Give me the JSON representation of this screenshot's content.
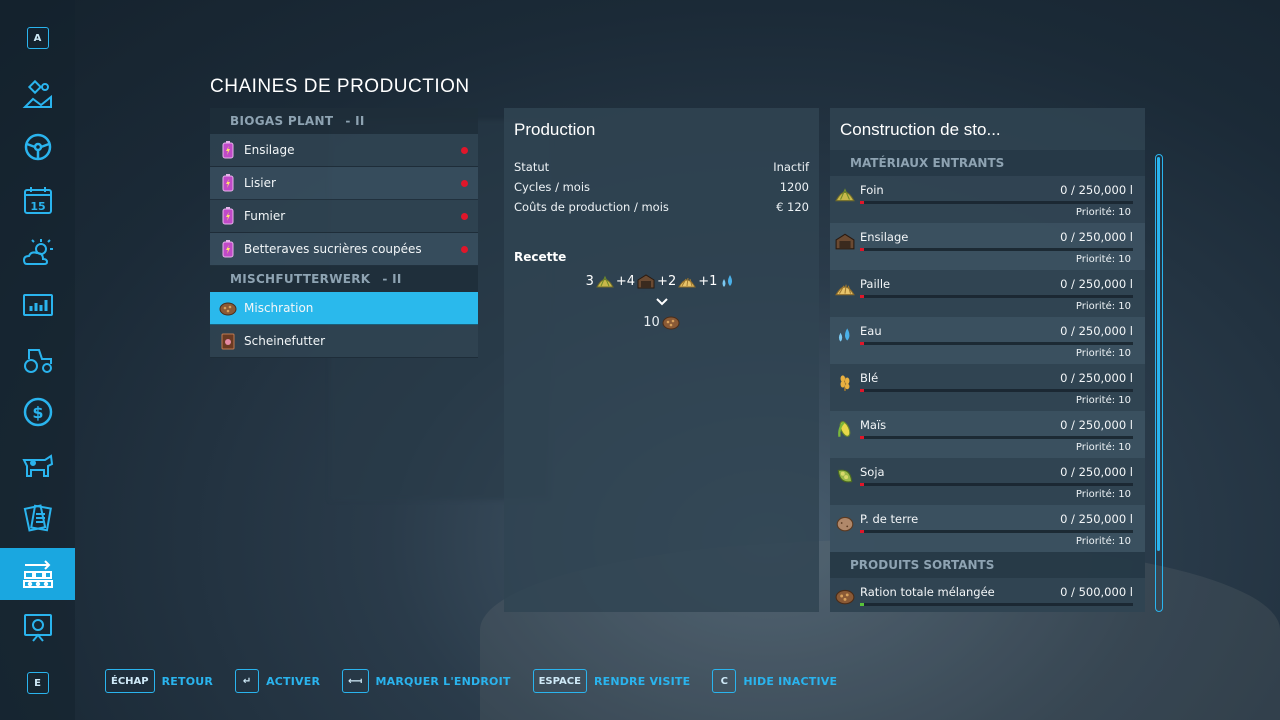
{
  "sidebar": {
    "top_key": "A",
    "bottom_key": "E",
    "items": [
      {
        "icon": "satellite-map-icon"
      },
      {
        "icon": "steering-wheel-icon"
      },
      {
        "icon": "calendar-icon",
        "label": "15"
      },
      {
        "icon": "weather-icon"
      },
      {
        "icon": "statistics-icon"
      },
      {
        "icon": "tractor-icon"
      },
      {
        "icon": "finance-icon",
        "label": "$"
      },
      {
        "icon": "animals-icon"
      },
      {
        "icon": "contracts-icon"
      },
      {
        "icon": "production-icon",
        "active": true
      },
      {
        "icon": "help-board-icon"
      }
    ]
  },
  "page": {
    "title": "CHAINES DE PRODUCTION"
  },
  "chains": [
    {
      "name": "BIOGAS PLANT",
      "suffix": "- II",
      "items": [
        {
          "label": "Ensilage",
          "icon": "battery-icon",
          "inactive": true
        },
        {
          "label": "Lisier",
          "icon": "battery-icon",
          "inactive": true
        },
        {
          "label": "Fumier",
          "icon": "battery-icon",
          "inactive": true
        },
        {
          "label": "Betteraves sucrières coupées",
          "icon": "battery-icon",
          "inactive": true
        }
      ]
    },
    {
      "name": "MISCHFUTTERWERK",
      "suffix": "- II",
      "items": [
        {
          "label": "Mischration",
          "icon": "feed-icon",
          "selected": true
        },
        {
          "label": "Scheinefutter",
          "icon": "pig-food-icon"
        }
      ]
    }
  ],
  "production": {
    "title": "Production",
    "rows": [
      {
        "label": "Statut",
        "value": "Inactif"
      },
      {
        "label": "Cycles / mois",
        "value": "1200"
      },
      {
        "label": "Coûts de production / mois",
        "value": "€ 120"
      }
    ],
    "recipe_label": "Recette",
    "recipe_inputs": [
      {
        "prefix": "3",
        "icon": "hay-icon"
      },
      {
        "prefix": "+4",
        "icon": "silage-icon"
      },
      {
        "prefix": "+2",
        "icon": "straw-icon"
      },
      {
        "prefix": "+1",
        "icon": "water-icon"
      }
    ],
    "recipe_output": {
      "amount": "10",
      "icon": "feed-icon"
    }
  },
  "storage": {
    "title": "Construction de sto...",
    "inputs_header": "MATÉRIAUX ENTRANTS",
    "outputs_header": "PRODUITS SORTANTS",
    "inputs": [
      {
        "name": "Foin",
        "amount": "0  / 250,000 l",
        "priority": "Priorité: 10",
        "icon": "hay-icon",
        "fill": 0
      },
      {
        "name": "Ensilage",
        "amount": "0  / 250,000 l",
        "priority": "Priorité: 10",
        "icon": "silage-icon",
        "fill": 0
      },
      {
        "name": "Paille",
        "amount": "0  / 250,000 l",
        "priority": "Priorité: 10",
        "icon": "straw-icon",
        "fill": 0
      },
      {
        "name": "Eau",
        "amount": "0  / 250,000 l",
        "priority": "Priorité: 10",
        "icon": "water-icon",
        "fill": 0
      },
      {
        "name": "Blé",
        "amount": "0  / 250,000 l",
        "priority": "Priorité: 10",
        "icon": "wheat-icon",
        "fill": 0
      },
      {
        "name": "Maïs",
        "amount": "0  / 250,000 l",
        "priority": "Priorité: 10",
        "icon": "corn-icon",
        "fill": 0
      },
      {
        "name": "Soja",
        "amount": "0  / 250,000 l",
        "priority": "Priorité: 10",
        "icon": "soybean-icon",
        "fill": 0
      },
      {
        "name": "P. de terre",
        "amount": "0  / 250,000 l",
        "priority": "Priorité: 10",
        "icon": "potato-icon",
        "fill": 0
      }
    ],
    "outputs": [
      {
        "name": "Ration totale mélangée",
        "amount": "0  / 500,000 l",
        "icon": "feed-icon",
        "fill": 0
      }
    ]
  },
  "footer": [
    {
      "key": "ÉCHAP",
      "label": "RETOUR"
    },
    {
      "key": "↵",
      "label": "ACTIVER"
    },
    {
      "key": "⟻",
      "label": "MARQUER L'ENDROIT"
    },
    {
      "key": "ESPACE",
      "label": "RENDRE VISITE"
    },
    {
      "key": "C",
      "label": "HIDE INACTIVE"
    }
  ],
  "colors": {
    "accent": "#2ab4ee",
    "selected": "#2ab9ec",
    "inactive_dot": "#e0162a"
  }
}
